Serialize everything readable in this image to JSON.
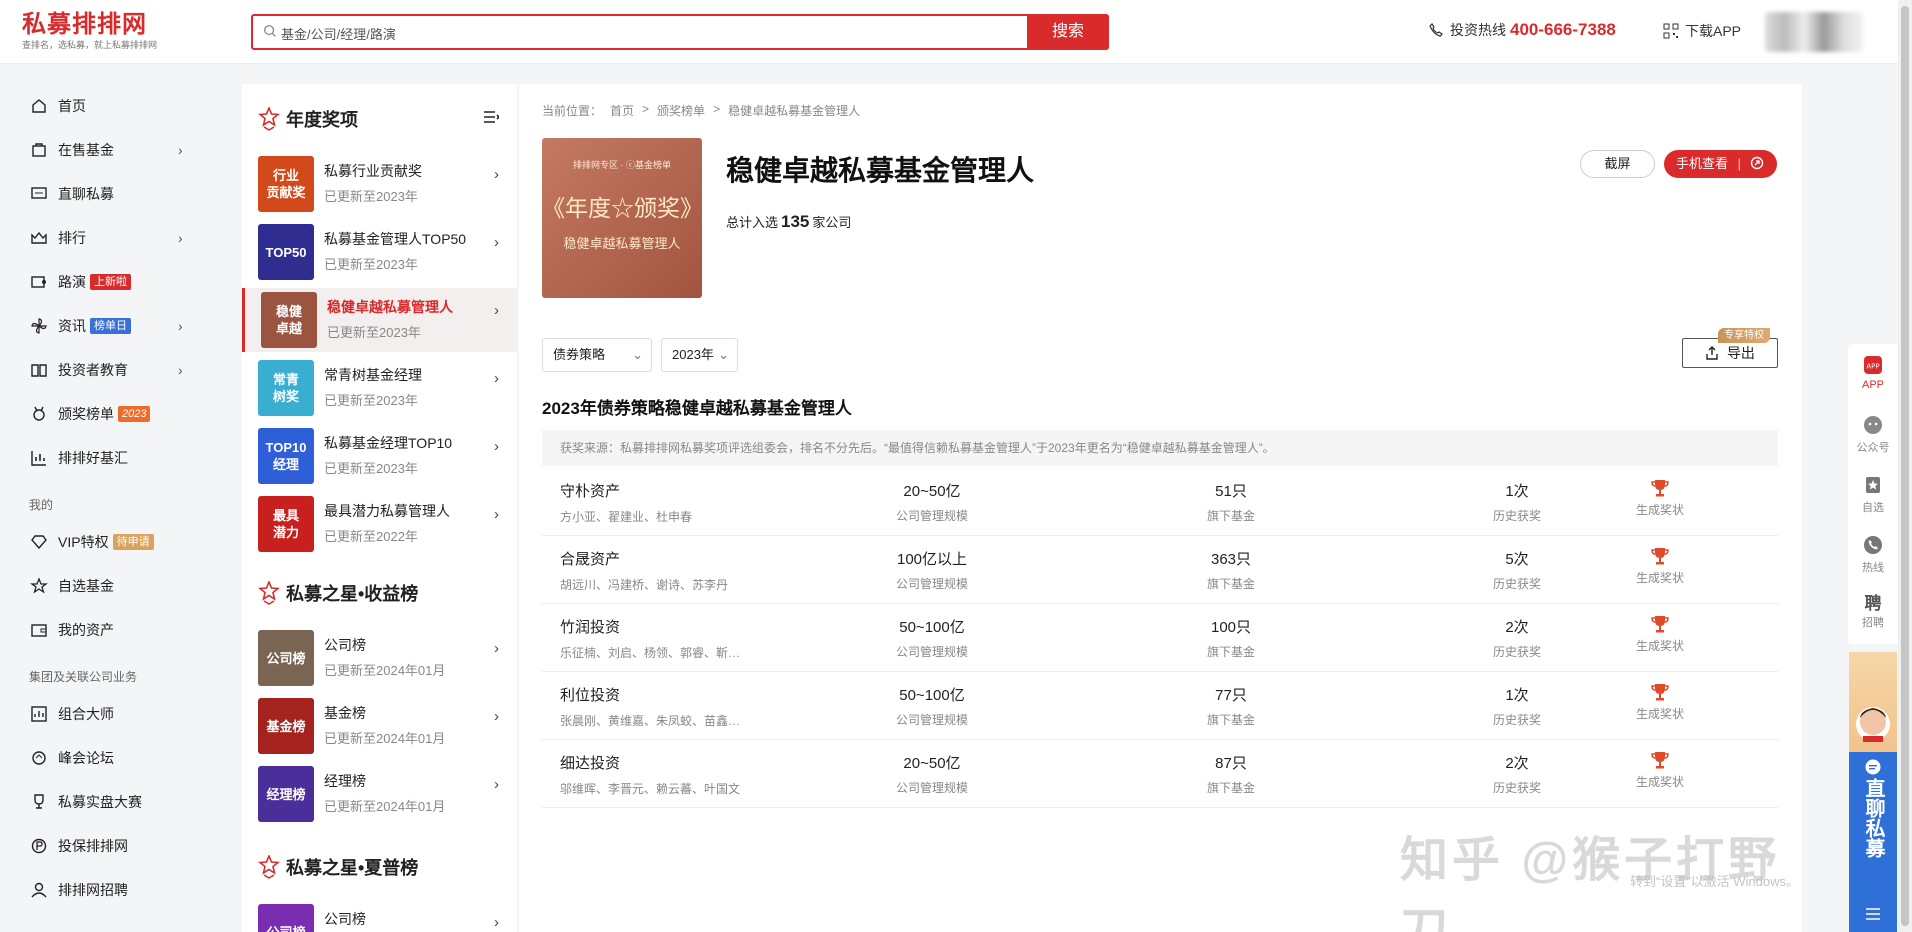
{
  "header": {
    "logo_title": "私募排排网",
    "logo_sub": "查排名，选私募，就上私募排排网",
    "search_placeholder": "基金/公司/经理/路演",
    "search_button": "搜索",
    "hotline_label": "投资热线",
    "hotline_number": "400-666-7388",
    "download_app": "下载APP"
  },
  "nav": {
    "items": [
      {
        "label": "首页",
        "icon": "home-icon"
      },
      {
        "label": "在售基金",
        "icon": "bag-icon",
        "chevron": true
      },
      {
        "label": "直聊私募",
        "icon": "chat-icon"
      },
      {
        "label": "排行",
        "icon": "crown-icon",
        "chevron": true
      },
      {
        "label": "路演",
        "icon": "video-icon",
        "badge": "上新啦"
      },
      {
        "label": "资讯",
        "icon": "pinwheel-icon",
        "badge": "榜单日",
        "chevron": true
      },
      {
        "label": "投资者教育",
        "icon": "book-icon",
        "chevron": true
      },
      {
        "label": "颁奖榜单",
        "icon": "medal-icon",
        "badge": "2023"
      },
      {
        "label": "排排好基汇",
        "icon": "chart-icon"
      }
    ],
    "section_mine": "我的",
    "mine_items": [
      {
        "label": "VIP特权",
        "icon": "diamond-icon",
        "badge": "待申请"
      },
      {
        "label": "自选基金",
        "icon": "star-icon"
      },
      {
        "label": "我的资产",
        "icon": "wallet-icon"
      }
    ],
    "section_group": "集团及关联公司业务",
    "group_items": [
      {
        "label": "组合大师",
        "icon": "combo-icon"
      },
      {
        "label": "峰会论坛",
        "icon": "forum-icon"
      },
      {
        "label": "私募实盘大赛",
        "icon": "trophy-icon"
      },
      {
        "label": "投保排排网",
        "icon": "shield-icon"
      },
      {
        "label": "排排网招聘",
        "icon": "person-icon"
      }
    ]
  },
  "awards": {
    "section1": "年度奖项",
    "section1_items": [
      {
        "thumb": "行业\n贡献奖",
        "color": "#d24a1b",
        "title": "私募行业贡献奖",
        "sub": "已更新至2023年"
      },
      {
        "thumb": "TOP50",
        "color": "#2f2d8f",
        "title": "私募基金管理人TOP50",
        "sub": "已更新至2023年"
      },
      {
        "thumb": "稳健\n卓越",
        "color": "#9b5440",
        "title": "稳健卓越私募管理人",
        "sub": "已更新至2023年",
        "active": true
      },
      {
        "thumb": "常青\n树奖",
        "color": "#3aaed0",
        "title": "常青树基金经理",
        "sub": "已更新至2023年"
      },
      {
        "thumb": "TOP10\n经理",
        "color": "#2f5fd8",
        "title": "私募基金经理TOP10",
        "sub": "已更新至2023年"
      },
      {
        "thumb": "最具\n潜力",
        "color": "#c8201f",
        "title": "最具潜力私募管理人",
        "sub": "已更新至2022年"
      }
    ],
    "section2": "私募之星•收益榜",
    "section2_items": [
      {
        "thumb": "公司榜",
        "color": "#7a6552",
        "title": "公司榜",
        "sub": "已更新至2024年01月"
      },
      {
        "thumb": "基金榜",
        "color": "#a4231f",
        "title": "基金榜",
        "sub": "已更新至2024年01月"
      },
      {
        "thumb": "经理榜",
        "color": "#4a2e9a",
        "title": "经理榜",
        "sub": "已更新至2024年01月"
      }
    ],
    "section3": "私募之星•夏普榜",
    "section3_items": [
      {
        "thumb": "公司榜",
        "color": "#7a2db0",
        "title": "公司榜",
        "sub": ""
      }
    ]
  },
  "main": {
    "breadcrumb": [
      "当前位置：",
      "首页",
      ">",
      "颁奖榜单",
      ">",
      "稳健卓越私募基金管理人"
    ],
    "cover": {
      "line1": "排排网专区 · ⓒ基金榜单",
      "line2": "《年度☆颁奖》",
      "line3": "稳健卓越私募管理人"
    },
    "title": "稳健卓越私募基金管理人",
    "total_prefix": "总计入选",
    "total_count": "135",
    "total_suffix": "家公司",
    "btn_screenshot": "截屏",
    "btn_mobile": "手机查看",
    "filter_strategy": "债券策略",
    "filter_year": "2023年",
    "export_label": "导出",
    "vip_tag": "专享特权",
    "list_title": "2023年债券策略稳健卓越私募基金管理人",
    "source_note": "获奖来源：私募排排网私募奖项评选组委会，排名不分先后。“最值得信赖私募基金管理人”于2023年更名为“稳健卓越私募基金管理人”。",
    "columns": {
      "scale": "公司管理规模",
      "funds": "旗下基金",
      "history": "历史获奖",
      "award": "生成奖状"
    },
    "rows": [
      {
        "name": "守朴资产",
        "people": "方小亚、翟建业、杜申春",
        "scale": "20~50亿",
        "funds": "51只",
        "history": "1次"
      },
      {
        "name": "合晟资产",
        "people": "胡远川、冯建桥、谢诗、苏李丹",
        "scale": "100亿以上",
        "funds": "363只",
        "history": "5次"
      },
      {
        "name": "竹润投资",
        "people": "乐征楠、刘启、杨领、郭睿、靳…",
        "scale": "50~100亿",
        "funds": "100只",
        "history": "2次"
      },
      {
        "name": "利位投资",
        "people": "张晨刚、黄维嘉、朱凤蛟、苗鑫…",
        "scale": "50~100亿",
        "funds": "77只",
        "history": "1次"
      },
      {
        "name": "细达投资",
        "people": "邬维晖、李晋元、赖云蕃、叶国文",
        "scale": "20~50亿",
        "funds": "87只",
        "history": "2次"
      }
    ]
  },
  "rail": {
    "items": [
      {
        "label": "APP",
        "icon": "app-icon"
      },
      {
        "label": "公众号",
        "icon": "wechat-icon"
      },
      {
        "label": "自选",
        "icon": "bookmark-icon"
      },
      {
        "label": "热线",
        "icon": "phone-icon"
      },
      {
        "label": "招聘",
        "icon": "recruit-icon"
      }
    ],
    "chat_label": "直聊私募"
  },
  "watermark": {
    "text": "知乎 @猴子打野刀",
    "activate": "转到“设置”以激活 Windows。"
  },
  "colors": {
    "brand": "#d92b2b",
    "blue": "#2f6fd8"
  }
}
